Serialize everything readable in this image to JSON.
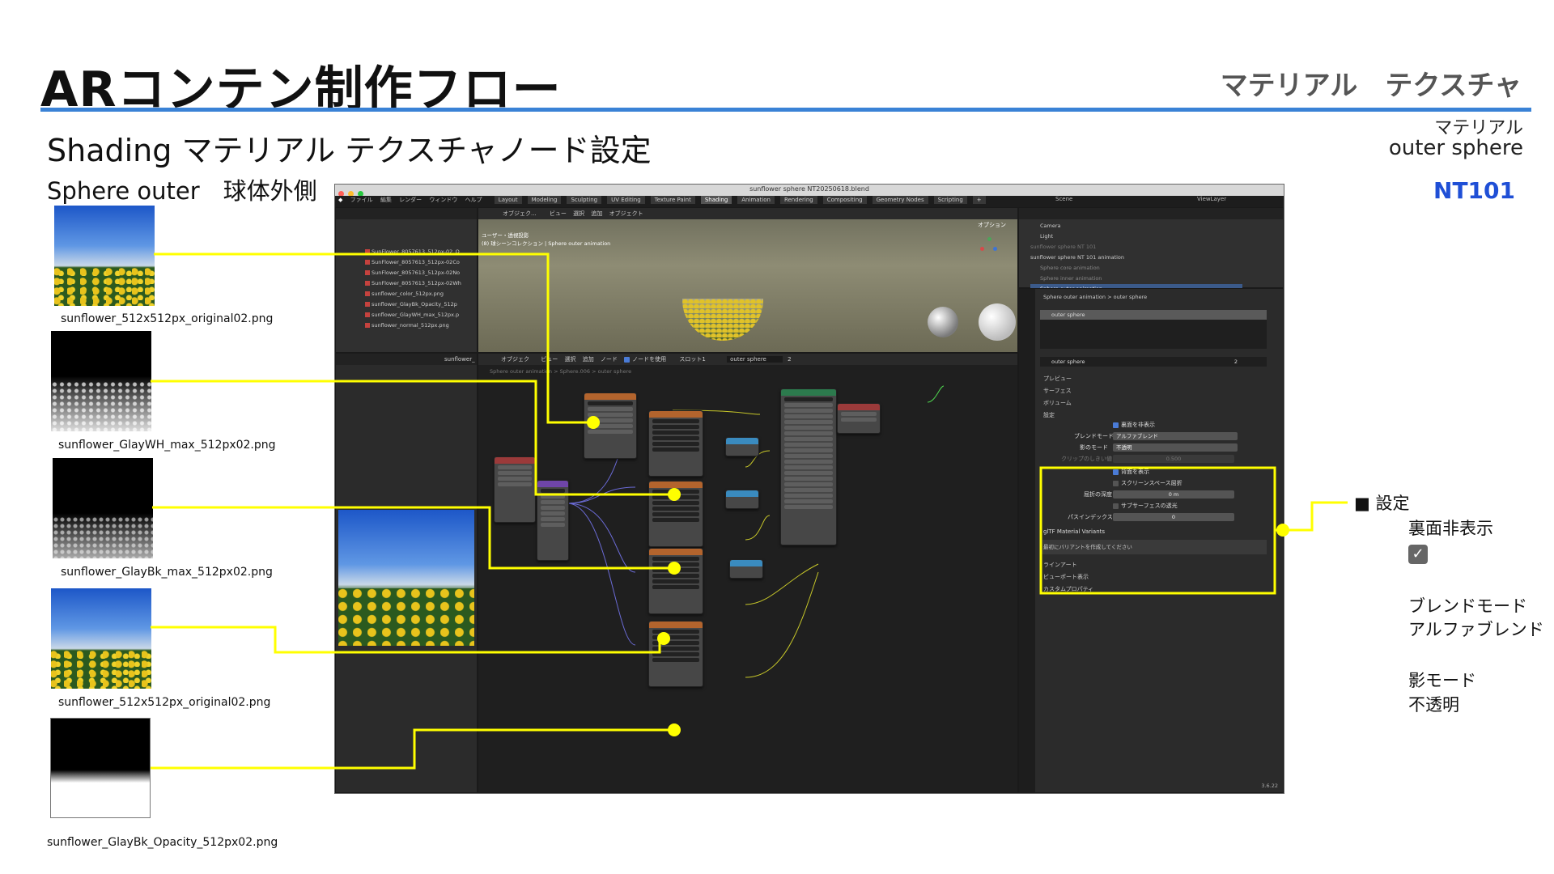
{
  "header": {
    "title": "ARコンテン制作フロー",
    "right_label": "マテリアル　テクスチャ"
  },
  "subtitle": "Shading マテリアル テクスチャノード設定",
  "section_label": "Sphere outer　球体外側",
  "material": {
    "label": "マテリアル",
    "name": "outer sphere",
    "code": "NT101"
  },
  "thumbnails": [
    {
      "caption": "sunflower_512x512px_original02.png"
    },
    {
      "caption": "sunflower_GlayWH_max_512px02.png"
    },
    {
      "caption": "sunflower_GlayBk_max_512px02.png"
    },
    {
      "caption": "sunflower_512x512px_original02.png"
    },
    {
      "caption": "sunflower_GlayBk_Opacity_512px02.png"
    }
  ],
  "blender": {
    "window_title": "sunflower sphere NT20250618.blend",
    "menu": [
      "ファイル",
      "編集",
      "レンダー",
      "ウィンドウ",
      "ヘルプ"
    ],
    "workspace_tabs": [
      "Layout",
      "Modeling",
      "Sculpting",
      "UV Editing",
      "Texture Paint",
      "Shading",
      "Animation",
      "Rendering",
      "Compositing",
      "Geometry Nodes",
      "Scripting"
    ],
    "active_tab": "Shading",
    "scene": "Scene",
    "view_layer": "ViewLayer",
    "file_browser": {
      "items": [
        "SunFlower_8057613_512px-02_O",
        "SunFlower_8057613_512px-02Co",
        "SunFlower_8057613_512px-02No",
        "SunFlower_8057613_512px-02Wh",
        "sunflower_color_512px.png",
        "sunflower_GlayBk_Opacity_512p",
        "sunflower_GlayWH_max_512px.p",
        "sunflower_normal_512px.png"
      ]
    },
    "viewport": {
      "mode": "オブジェク...",
      "menu": [
        "ビュー",
        "選択",
        "追加",
        "オブジェクト"
      ],
      "options": "オプション",
      "info_line1": "ユーザー・透視投影",
      "info_line2": "(8) 球シーンコレクション | Sphere outer animation"
    },
    "outliner": {
      "items": [
        "Camera",
        "Light",
        "sunflower sphere NT 101",
        "sunflower sphere NT 101 animation",
        "Sphere core animation",
        "Sphere inner animation",
        "Sphere outer animation"
      ]
    },
    "node_editor": {
      "mode": "オブジェク",
      "menu": [
        "ビュー",
        "選択",
        "追加",
        "ノード"
      ],
      "use_nodes": "ノードを使用",
      "slot": "スロット1",
      "material_field": "outer sphere",
      "user_count": "2",
      "breadcrumb": [
        "Sphere outer animation",
        "Sphere.006",
        "outer sphere"
      ],
      "image_panel_label": "sunflower_"
    },
    "properties": {
      "breadcrumb": [
        "Sphere outer animation",
        "outer sphere"
      ],
      "slot_item": "outer sphere",
      "material_field": "outer sphere",
      "user_count": "2",
      "sections": [
        "プレビュー",
        "サーフェス",
        "ボリューム",
        "設定"
      ],
      "backface_culling": "裏面を非表示",
      "blend_mode_label": "ブレンドモード",
      "blend_mode_value": "アルファブレンド",
      "shadow_mode_label": "影のモード",
      "shadow_mode_value": "不透明",
      "clip_threshold_label": "クリップのしきい値",
      "clip_threshold_value": "0.500",
      "show_backface": "背面を表示",
      "screen_space_refraction": "スクリーンスペース屈折",
      "refraction_depth_label": "屈折の深度",
      "refraction_depth_value": "0 m",
      "subsurface_translucency": "サブサーフェスの透光",
      "pass_index_label": "パスインデックス",
      "pass_index_value": "0",
      "gltf_section": "glTF Material Variants",
      "gltf_hint": "最初にバリアントを作成してください",
      "more_sections": [
        "ラインアート",
        "ビューポート表示",
        "カスタムプロパティ"
      ]
    },
    "version": "3.6.22"
  },
  "annotation": {
    "heading": "■ 設定",
    "backface": "裏面非表示",
    "blend_label": "ブレンドモード",
    "blend_value": "アルファブレンド",
    "shadow_label": "影モード",
    "shadow_value": "不透明"
  },
  "colors": {
    "accent_rule": "#3a82d6",
    "code_blue": "#1f4fd6",
    "connector_yellow": "#ffff00"
  }
}
